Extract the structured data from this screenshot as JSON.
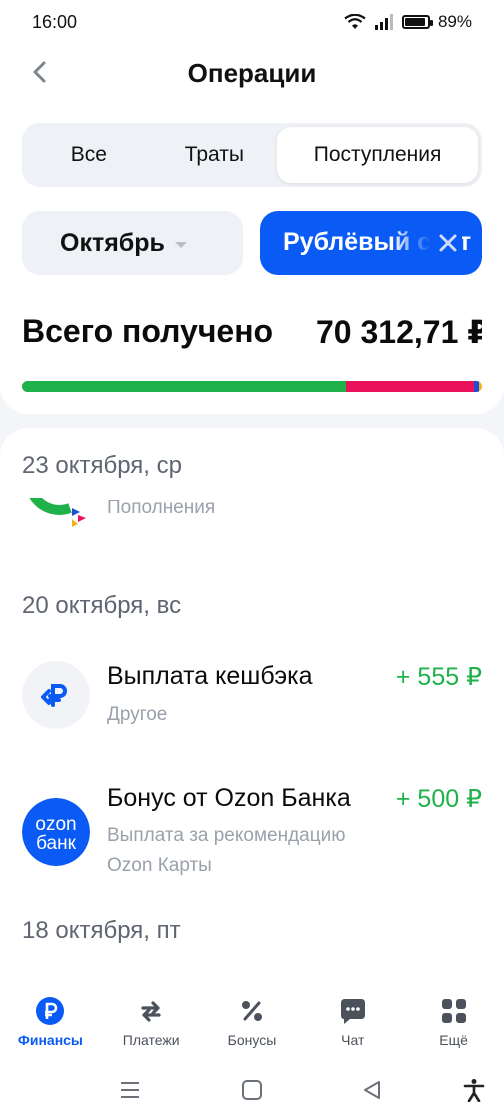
{
  "status_bar": {
    "time": "16:00",
    "battery": "89%",
    "battery_level": 0.89
  },
  "header": {
    "title": "Операции",
    "back_icon": "chevron-left-icon"
  },
  "tabs": [
    {
      "label": "Все",
      "active": false
    },
    {
      "label": "Траты",
      "active": false
    },
    {
      "label": "Поступления",
      "active": true
    }
  ],
  "filters": {
    "month": "Октябрь",
    "currency": "Рублёвый счёт"
  },
  "summary": {
    "label": "Всего получено",
    "amount": "70 312,71 ₽",
    "breakdown": [
      {
        "color": "#1fb14a",
        "share": 0.705
      },
      {
        "color": "#e8115a",
        "share": 0.278
      },
      {
        "color": "#1d4fd6",
        "share": 0.011
      },
      {
        "color": "#f2b21b",
        "share": 0.006
      }
    ]
  },
  "groups": [
    {
      "date": "23 октября, ср",
      "items": [
        {
          "subtitle": "Пополнения"
        }
      ]
    },
    {
      "date": "20 октября, вс",
      "items": [
        {
          "title": "Выплата кешбэка",
          "subtitle": "Другое",
          "amount": "+ 555 ₽",
          "icon": "cashback-ruble-icon"
        },
        {
          "title": "Бонус от Ozon Банка",
          "subtitle": "Выплата за рекомендацию",
          "subtitle2": "Ozon Карты",
          "amount": "+ 500 ₽",
          "icon": "ozon-bank-logo",
          "logo_text": [
            "ozon",
            "банк"
          ]
        }
      ]
    },
    {
      "date": "18 октября, пт",
      "items": []
    }
  ],
  "bottom_nav": [
    {
      "label": "Финансы",
      "icon": "ruble-circle-icon",
      "active": true
    },
    {
      "label": "Платежи",
      "icon": "transfer-arrows-icon",
      "active": false
    },
    {
      "label": "Бонусы",
      "icon": "percent-icon",
      "active": false
    },
    {
      "label": "Чат",
      "icon": "chat-bubble-icon",
      "active": false
    },
    {
      "label": "Ещё",
      "icon": "grid-icon",
      "active": false
    }
  ],
  "colors": {
    "accent": "#0a5bf5",
    "income": "#1fb14a"
  }
}
